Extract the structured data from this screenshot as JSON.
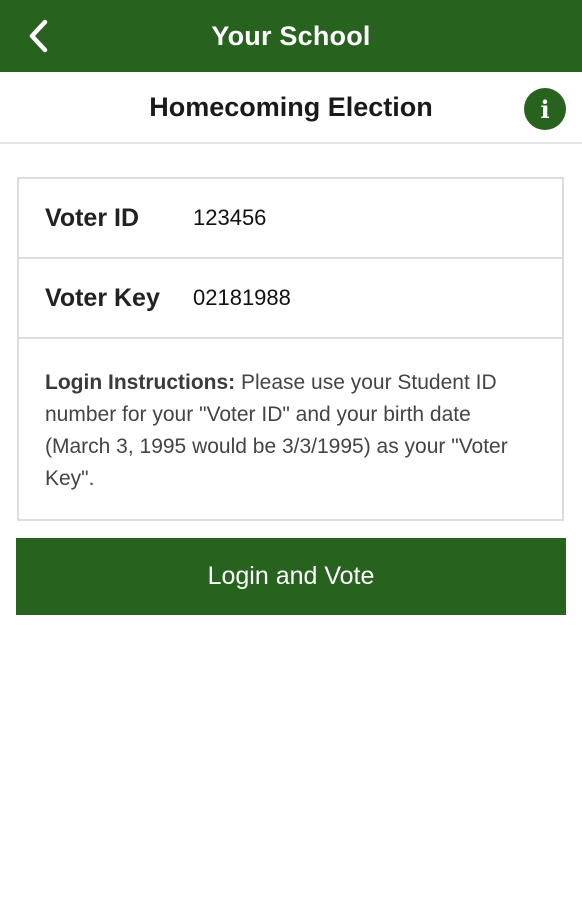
{
  "colors": {
    "brand": "#27621f",
    "page_background": "#ffffff",
    "border": "#dcdcdc"
  },
  "app_bar": {
    "title": "Your School",
    "back_icon": "chevron-left-icon"
  },
  "subheader": {
    "title": "Homecoming Election",
    "info_icon_glyph": "i"
  },
  "form": {
    "voter_id": {
      "label": "Voter ID",
      "value": "123456"
    },
    "voter_key": {
      "label": "Voter Key",
      "value": "02181988"
    },
    "instructions": {
      "lead": "Login Instructions:",
      "text": " Please use your Student ID number for your \"Voter ID\" and your birth date (March 3, 1995 would be 3/3/1995) as your \"Voter Key\"."
    }
  },
  "actions": {
    "login_label": "Login and Vote"
  }
}
